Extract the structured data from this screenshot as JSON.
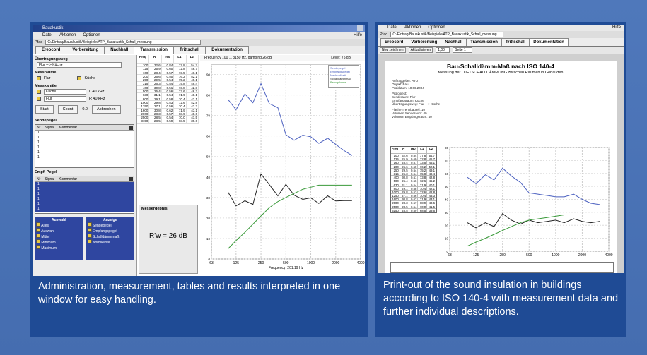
{
  "captions": {
    "left": "Administration, measurement, tables and results interpreted in one window for easy handling.",
    "right": "Print-out of the sound insulation in buildings according to ISO 140-4 with measurement data and further individual descriptions."
  },
  "colors": {
    "background": "#4a73b5",
    "panel": "#1f4b95",
    "blue_curve": "#4a5fbf",
    "black_curve": "#222222",
    "green_curve": "#3a9a3a"
  },
  "app": {
    "title": "Bauakustik",
    "menu": [
      "Datei",
      "Aktionen",
      "Optionen"
    ],
    "help": "Hilfe",
    "path": "C:/Eintrag/Bauakustik/Beispiele/ATP_Bauakustik_Schall_messung",
    "tabs": [
      "Ereocord",
      "Vorbereitung",
      "Nachhall",
      "Transmission",
      "Trittschall",
      "Dokumentation"
    ],
    "left_panel": {
      "section1": "Übertragungsweg",
      "path_value": "Flur ---> Küche",
      "section2": "Messräume",
      "room1": "Flur",
      "room2": "Küche",
      "section3": "Messkanäle",
      "ch1": "Küche",
      "ch2": "Flur",
      "ch1_level": "L 40 kHz",
      "ch2_level": "R 40 kHz",
      "start": "Start",
      "count": "Count",
      "count_val": "0.0",
      "abort": "Abbrechen",
      "send_level": "Sendepegel",
      "receive_level": "Empf. Pegel",
      "list_head": [
        "Nr",
        "Signal",
        "Kommentar"
      ],
      "list_rows": [
        "1",
        "1",
        "1",
        "1",
        "1",
        "1"
      ],
      "select_title": "Auswahl",
      "display_title": "Anzeige",
      "select_items": [
        "Alles",
        "Auswahl",
        "Mittel",
        "Minimum",
        "Maximum"
      ],
      "display_items": [
        "Sendepegel",
        "Empfangspegel",
        "Schalldämmmaß",
        "Normkurve"
      ]
    },
    "table": {
      "head": [
        "Freq",
        "R'",
        "T60",
        "L1",
        "L2"
      ],
      "rows": [
        [
          "100",
          "32.6",
          "0.84",
          "77.8",
          "54.7"
        ],
        [
          "125",
          "25.9",
          "0.60",
          "72.8",
          "46.7"
        ],
        [
          "160",
          "28.4",
          "0.57",
          "73.5",
          "46.1"
        ],
        [
          "200",
          "26.6",
          "0.50",
          "76.2",
          "52.1"
        ],
        [
          "250",
          "29.5",
          "0.54",
          "75.2",
          "49.1"
        ],
        [
          "315",
          "26.3",
          "0.54",
          "75.8",
          "49.4"
        ],
        [
          "400",
          "30.8",
          "0.51",
          "73.8",
          "42.8"
        ],
        [
          "500",
          "26.4",
          "0.56",
          "72.6",
          "46.2"
        ],
        [
          "630",
          "31.1",
          "0.54",
          "71.9",
          "40.1"
        ],
        [
          "800",
          "29.1",
          "0.58",
          "70.4",
          "42.1"
        ],
        [
          "1000",
          "29.8",
          "0.53",
          "72.6",
          "42.8"
        ],
        [
          "1250",
          "27.1",
          "0.56",
          "70.4",
          "43.3"
        ],
        [
          "1600",
          "30.8",
          "0.62",
          "71.9",
          "43.1"
        ],
        [
          "2000",
          "28.3",
          "0.57",
          "68.9",
          "40.6"
        ],
        [
          "2500",
          "28.5",
          "0.54",
          "70.0",
          "41.5"
        ],
        [
          "3150",
          "28.5",
          "0.59",
          "68.5",
          "39.6"
        ]
      ]
    },
    "result_label": "Messergebnis",
    "result_value": "R'w = 26 dB",
    "chart_header": "Frequency 100 ... 3150 Hz, damping 26 dB",
    "chart_level": "Level: 75 dB",
    "legend": [
      "Sendepegel",
      "Empfangspegel",
      "Nachhallzeit",
      "Schalldämmmaß",
      "Bezugskurve"
    ],
    "xlabel": "Frequency: 201.19 Hz"
  },
  "doc": {
    "tabs": [
      "Ereocord",
      "Vorbereitung",
      "Nachhall",
      "Transmission",
      "Trittschall",
      "Dokumentation"
    ],
    "toolbar": [
      "Neu zeichnen",
      "Aktualisieren",
      "1,00",
      "Seite 1"
    ],
    "title": "Bau-Schalldämm-Maß nach ISO 140-4",
    "subtitle": "Messung der LUFTSCHALLDÄMMUNG zwischen Räumen in Gebäuden",
    "info": [
      "Auftraggeber: ATO",
      "Objekt: Bau",
      "Prüfdatum: 10.06.2004",
      "Prüfobjekt:",
      "Senderaum: Flur",
      "Empfangsraum: Küche",
      "Übertragungsweg: Flur ---> Küche",
      "Fläche Trennbauteil: 10",
      "Volumen Senderaum: 40",
      "Volumen Empfangsraum: 40"
    ]
  },
  "chart_data": [
    {
      "type": "line",
      "title": "",
      "xlabel": "Frequency: 201.19 Hz",
      "ylabel": "",
      "x": [
        100,
        125,
        160,
        200,
        250,
        315,
        400,
        500,
        630,
        800,
        1000,
        1250,
        1600,
        2000,
        2500,
        3150
      ],
      "xticks": [
        "63",
        "125",
        "250",
        "500",
        "1000",
        "2000",
        "4000"
      ],
      "ylim": [
        0,
        95
      ],
      "series": [
        {
          "name": "Sendepegel",
          "values": [
            77.8,
            72.8,
            80.5,
            76.2,
            85.5,
            75.8,
            73.8,
            60.6,
            57.9,
            60.4,
            59.6,
            56.4,
            58.9,
            55.9,
            53.0,
            50.5
          ]
        },
        {
          "name": "Empfangspegel",
          "values": [
            32.6,
            25.9,
            28.4,
            26.6,
            41.5,
            36.3,
            30.8,
            36.4,
            31.1,
            29.1,
            29.8,
            27.1,
            30.8,
            28.3,
            28.5,
            28.5
          ]
        },
        {
          "name": "Bezugskurve",
          "values": [
            5,
            9,
            13,
            17,
            21,
            25,
            28,
            30,
            32,
            34,
            35,
            36,
            36,
            36,
            36,
            36
          ]
        }
      ]
    },
    {
      "type": "line",
      "title": "",
      "xlabel": "",
      "ylabel": "",
      "x": [
        100,
        125,
        160,
        200,
        250,
        315,
        400,
        500,
        630,
        800,
        1000,
        1250,
        1600,
        2000,
        2500,
        3150
      ],
      "xticks": [
        "63",
        "125",
        "250",
        "500",
        "1000",
        "2000",
        "4000"
      ],
      "ylim": [
        0,
        80
      ],
      "series": [
        {
          "name": "R'",
          "values": [
            57,
            52,
            59,
            55,
            64,
            58,
            53,
            45,
            44,
            43,
            42,
            42,
            44,
            40,
            37,
            36
          ]
        },
        {
          "name": "R'",
          "values": [
            22,
            18,
            22,
            19,
            29,
            24,
            21,
            24,
            22,
            23,
            24,
            22,
            25,
            23,
            22,
            23
          ]
        },
        {
          "name": "Bezugskurve",
          "values": [
            4,
            7,
            10,
            13,
            16,
            19,
            22,
            24,
            25,
            26,
            27,
            28,
            28,
            28,
            28,
            28
          ]
        }
      ]
    }
  ]
}
